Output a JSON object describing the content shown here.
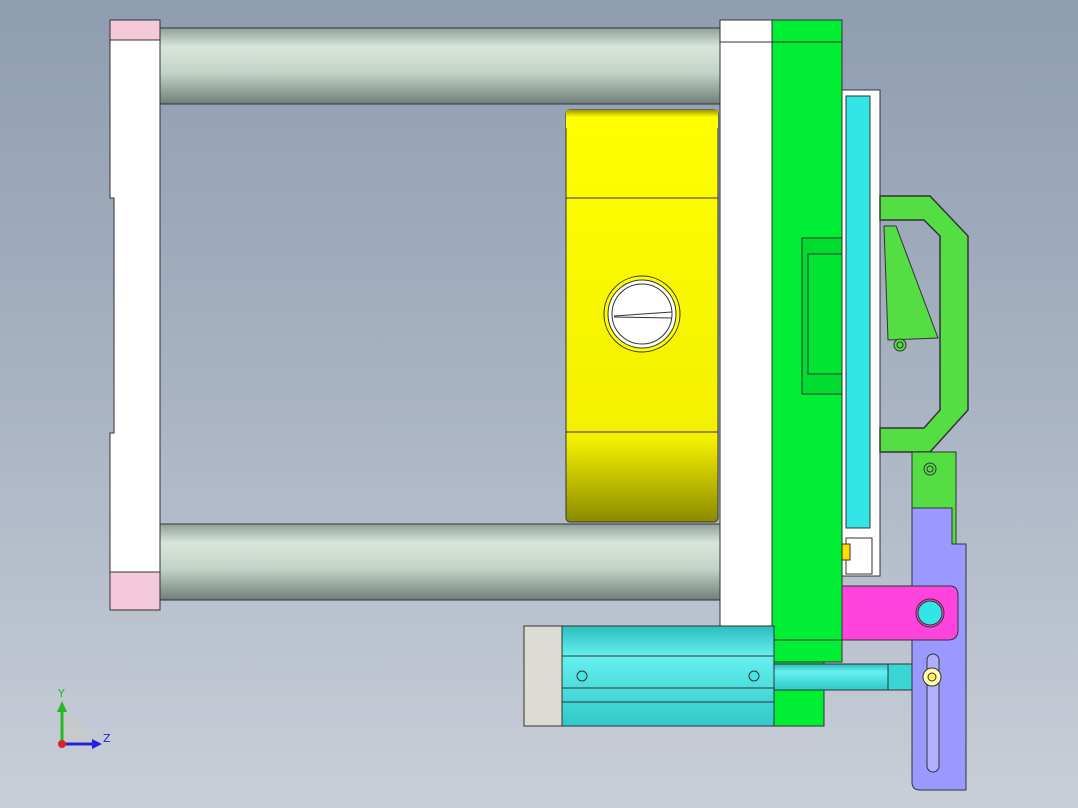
{
  "viewport": {
    "background_top": "#8f9db1",
    "background_bottom": "#c9cfd8"
  },
  "triad": {
    "y_label": "Y",
    "z_label": "Z",
    "y_color": "#22bb22",
    "z_color": "#2222dd",
    "x_color": "#dd2222"
  },
  "parts": {
    "rods": "#c2d1c6",
    "platen": "#ffffff",
    "platen_pink": "#f4c9d9",
    "yellow_block": "#ffff00",
    "green_plate": "#00ee33",
    "cyan_plate": "#33e6e6",
    "handle": "#55dd44",
    "magenta_block": "#ff44dd",
    "lavender_bracket": "#9999ff",
    "cylinder": "#44e4e4",
    "cylinder_cap": "#dcdcd4"
  }
}
